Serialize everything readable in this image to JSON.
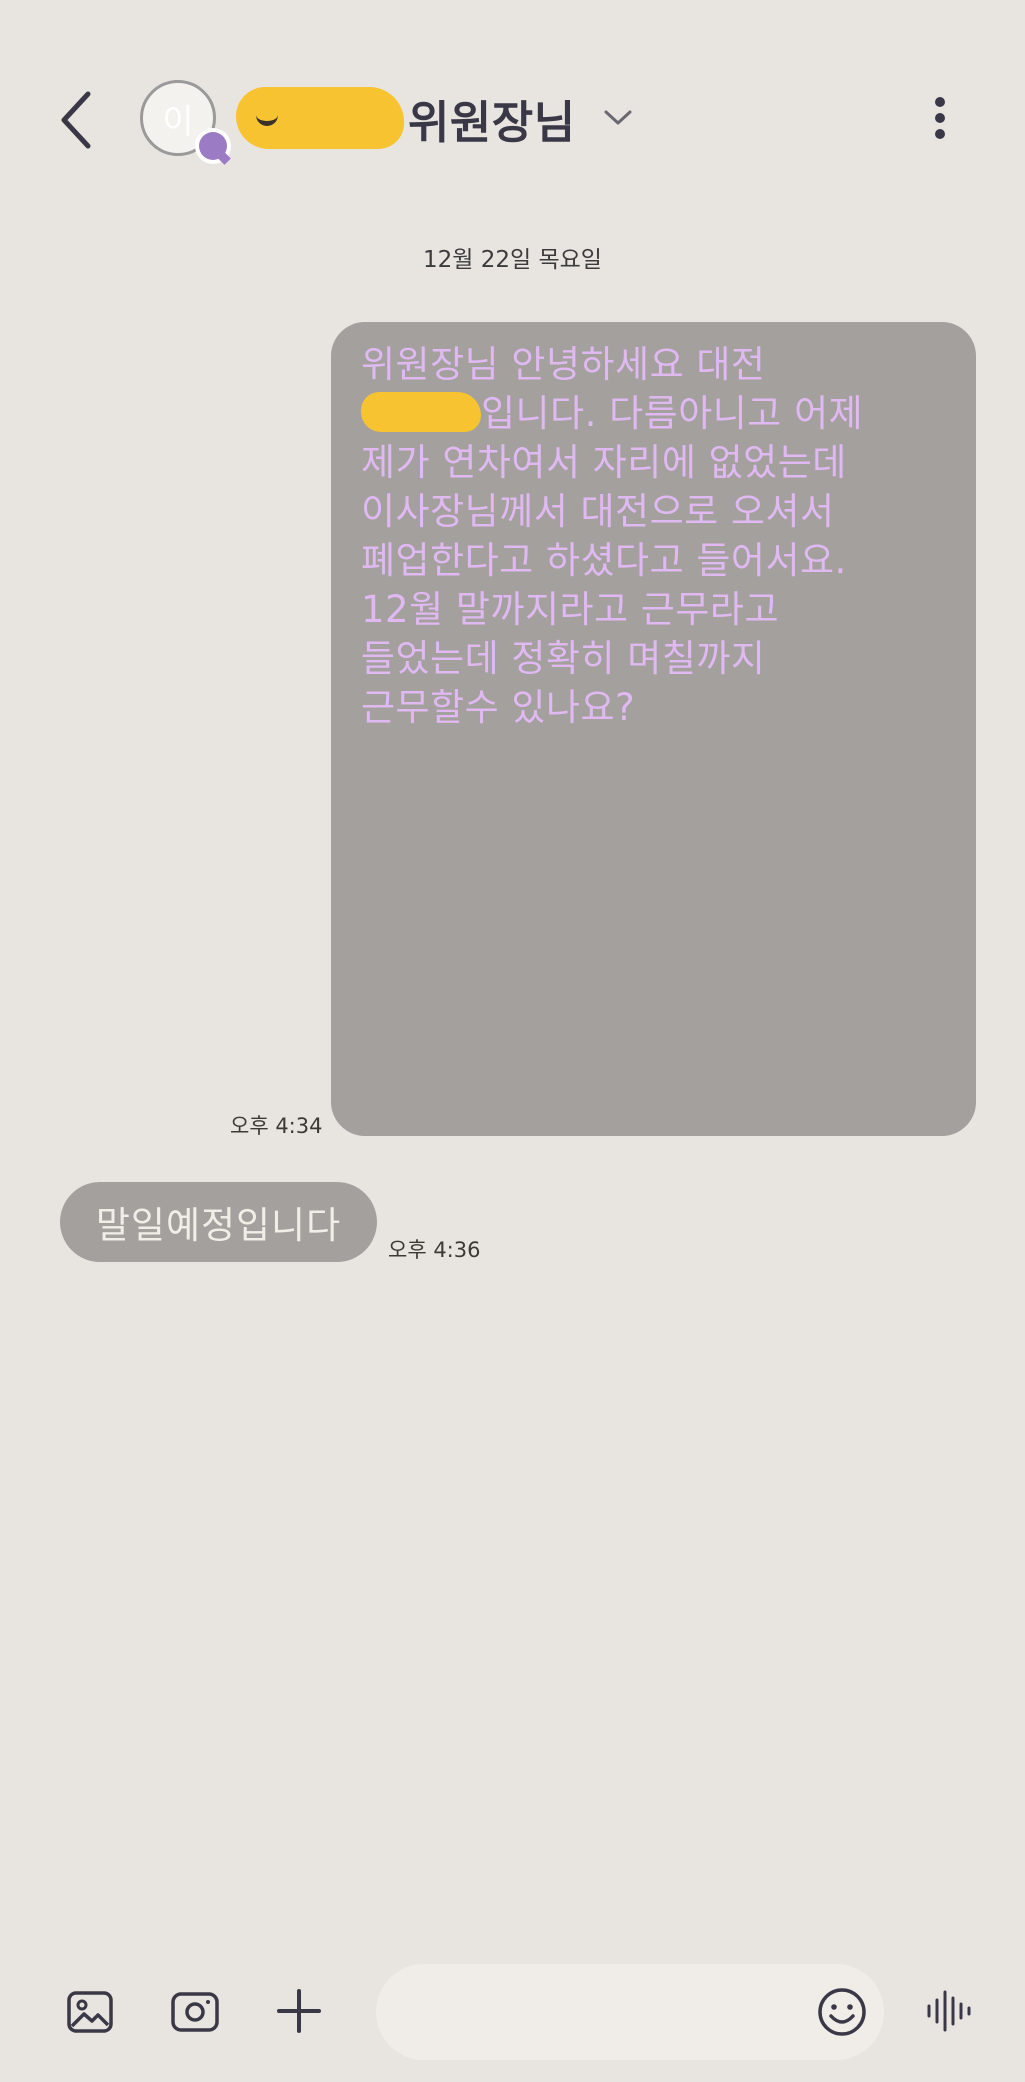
{
  "header": {
    "avatar_initial": "이",
    "contact_name": "위원장님"
  },
  "conversation": {
    "date_separator": "12월 22일 목요일",
    "outgoing": {
      "lines": [
        "위원장님 안녕하세요 대전",
        "입니다. 다름아니고 어제",
        "제가 연차여서 자리에 없었는데",
        "이사장님께서 대전으로 오셔서",
        "폐업한다고 하셨다고 들어서요.",
        "12월 말까지라고 근무라고",
        "들었는데 정확히 며칠까지",
        "근무할수 있나요?"
      ],
      "time": "오후 4:34"
    },
    "incoming": {
      "text": "말일예정입니다",
      "time": "오후 4:36"
    }
  },
  "composer": {
    "placeholder": "",
    "value": ""
  },
  "colors": {
    "background": "#e8e5e1",
    "bubble": "#a3a09d",
    "outgoing_text": "#e0b8f2",
    "incoming_text": "#f1eee8",
    "accent": "#9b7cc4",
    "redaction": "#f7c330"
  }
}
